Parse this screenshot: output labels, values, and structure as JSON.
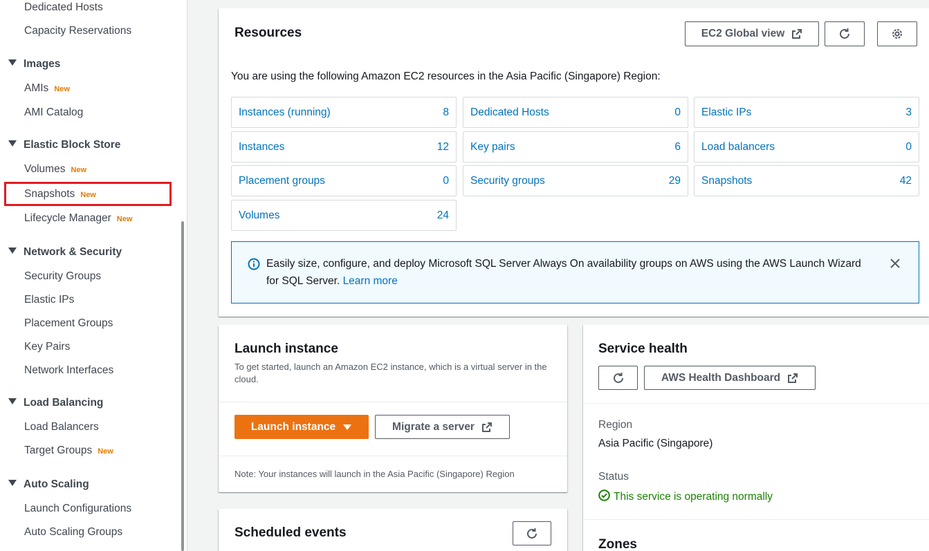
{
  "sidebar": {
    "items_top": [
      "Dedicated Hosts",
      "Capacity Reservations"
    ],
    "images": {
      "title": "Images",
      "amis": "AMIs",
      "ami_catalog": "AMI Catalog"
    },
    "ebs": {
      "title": "Elastic Block Store",
      "volumes": "Volumes",
      "snapshots": "Snapshots",
      "lifecycle": "Lifecycle Manager"
    },
    "network": {
      "title": "Network & Security",
      "security_groups": "Security Groups",
      "elastic_ips": "Elastic IPs",
      "placement_groups": "Placement Groups",
      "key_pairs": "Key Pairs",
      "network_interfaces": "Network Interfaces"
    },
    "lb": {
      "title": "Load Balancing",
      "load_balancers": "Load Balancers",
      "target_groups": "Target Groups"
    },
    "as": {
      "title": "Auto Scaling",
      "launch_configurations": "Launch Configurations",
      "asg": "Auto Scaling Groups"
    },
    "new_badge": "New"
  },
  "resources": {
    "title": "Resources",
    "global_view": "EC2 Global view",
    "intro": "You are using the following Amazon EC2 resources in the Asia Pacific (Singapore) Region:",
    "cells": [
      {
        "label": "Instances (running)",
        "count": "8"
      },
      {
        "label": "Dedicated Hosts",
        "count": "0"
      },
      {
        "label": "Elastic IPs",
        "count": "3"
      },
      {
        "label": "Instances",
        "count": "12"
      },
      {
        "label": "Key pairs",
        "count": "6"
      },
      {
        "label": "Load balancers",
        "count": "0"
      },
      {
        "label": "Placement groups",
        "count": "0"
      },
      {
        "label": "Security groups",
        "count": "29"
      },
      {
        "label": "Snapshots",
        "count": "42"
      },
      {
        "label": "Volumes",
        "count": "24"
      }
    ],
    "alert_text": "Easily size, configure, and deploy Microsoft SQL Server Always On availability groups on AWS using the AWS Launch Wizard for SQL Server.",
    "alert_link": "Learn more"
  },
  "launch": {
    "title": "Launch instance",
    "desc": "To get started, launch an Amazon EC2 instance, which is a virtual server in the cloud.",
    "launch_btn": "Launch instance",
    "migrate_btn": "Migrate a server",
    "note": "Note: Your instances will launch in the Asia Pacific (Singapore) Region"
  },
  "health": {
    "title": "Service health",
    "dashboard_btn": "AWS Health Dashboard",
    "region_label": "Region",
    "region_value": "Asia Pacific (Singapore)",
    "status_label": "Status",
    "status_value": "This service is operating normally",
    "zones_title": "Zones"
  },
  "scheduled": {
    "title": "Scheduled events"
  },
  "colors": {
    "link": "#0073bb",
    "primary": "#ec7211",
    "success": "#1d8102",
    "highlight": "#e11b22",
    "new_badge": "#e07b00"
  }
}
